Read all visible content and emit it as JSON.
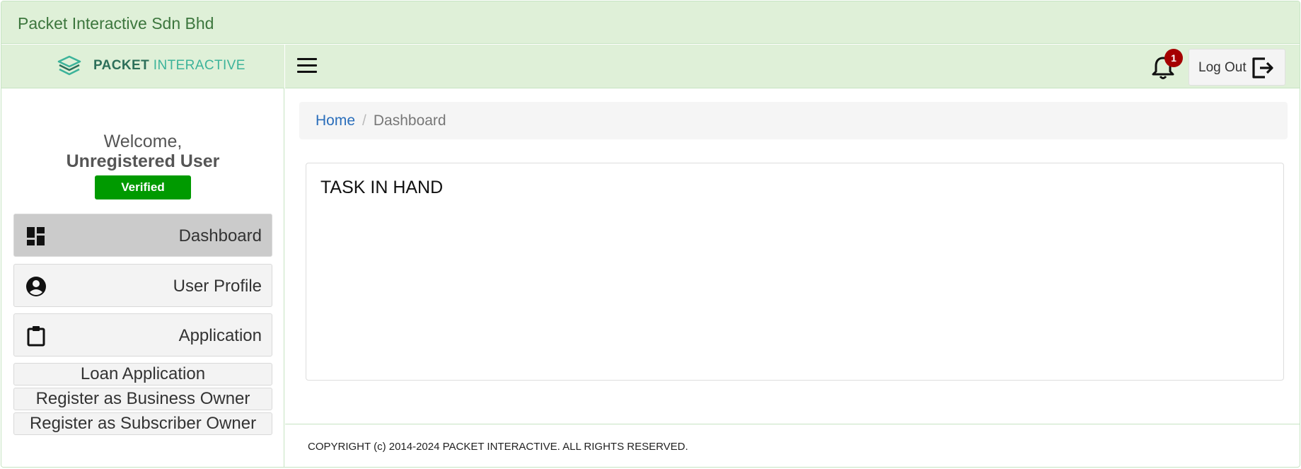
{
  "topbar": {
    "company": "Packet Interactive Sdn Bhd"
  },
  "logo": {
    "part1": "PACKET",
    "part2": "INTERACTIVE"
  },
  "sidebar": {
    "welcome": "Welcome,",
    "username": "Unregistered User",
    "status_badge": "Verified",
    "menu": [
      {
        "label": "Dashboard",
        "icon": "dashboard-icon",
        "active": true
      },
      {
        "label": "User Profile",
        "icon": "account-circle-icon",
        "active": false
      },
      {
        "label": "Application",
        "icon": "clipboard-icon",
        "active": false
      }
    ],
    "sub_items": [
      {
        "label": "Loan Application"
      },
      {
        "label": "Register as Business Owner"
      },
      {
        "label": "Register as Subscriber Owner"
      }
    ]
  },
  "header": {
    "notification_count": "1",
    "logout_label": "Log Out"
  },
  "breadcrumb": {
    "home": "Home",
    "separator": "/",
    "current": "Dashboard"
  },
  "main": {
    "task_title": "TASK IN HAND"
  },
  "footer": {
    "copyright": "COPYRIGHT (c) 2014-2024 PACKET INTERACTIVE. ALL RIGHTS RESERVED."
  },
  "colors": {
    "topbar_bg": "#dff0d8",
    "company_text": "#3c763d",
    "verified_bg": "#009a00",
    "badge_bg": "#a50000",
    "link": "#2a6ebb"
  }
}
